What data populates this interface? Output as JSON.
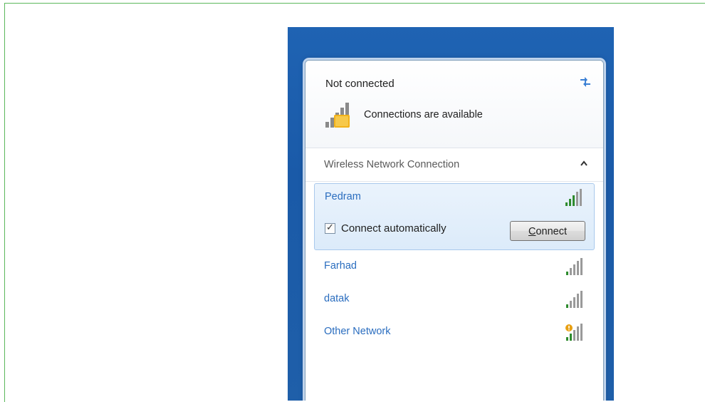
{
  "header": {
    "status": "Not connected",
    "availability": "Connections are available",
    "refresh_icon": "refresh-icon"
  },
  "section": {
    "title": "Wireless Network Connection",
    "collapse_icon": "chevron-up-icon"
  },
  "networks": [
    {
      "name": "Pedram",
      "signal": 4,
      "selected": true
    },
    {
      "name": "Farhad",
      "signal": 4,
      "selected": false
    },
    {
      "name": "datak",
      "signal": 4,
      "selected": false
    },
    {
      "name": "Other Network",
      "signal": 4,
      "selected": false,
      "warning": true
    }
  ],
  "selected_network": {
    "connect_automatically_label": "Connect automatically",
    "connect_automatically_checked": true,
    "connect_button": {
      "prefix": "",
      "underlined": "C",
      "rest": "onnect"
    }
  },
  "colors": {
    "frame_border": "#5cb85c",
    "desktop_blue": "#1f63b3",
    "link_blue": "#2a6dbf",
    "signal_green": "#2e8b2e",
    "signal_gray": "#9a9a9a"
  }
}
